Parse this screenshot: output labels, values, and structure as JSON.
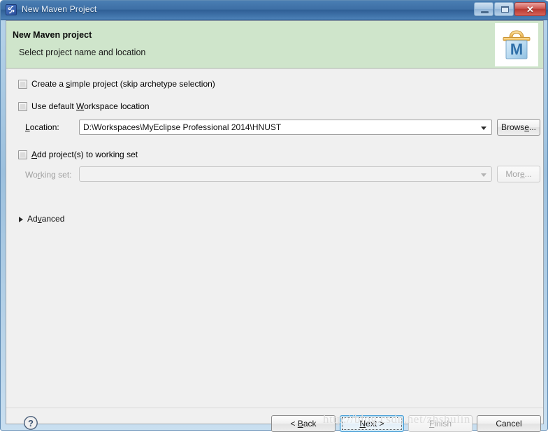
{
  "window": {
    "title": "New Maven Project",
    "icon": "myeclipse-logo-icon",
    "controls": {
      "minimize": "Minimize",
      "maximize": "Maximize",
      "close": "Close",
      "close_glyph": "✕"
    }
  },
  "banner": {
    "title": "New Maven project",
    "subtitle": "Select project name and location",
    "icon": "maven-project-icon",
    "icon_letter": "M",
    "background_color": "#cfe5cb"
  },
  "form": {
    "simple_project": {
      "label_before": "Create a ",
      "label_mnemonic": "s",
      "label_after": "imple project (skip archetype selection)",
      "checked": false
    },
    "default_workspace": {
      "label_before": "Use default ",
      "label_mnemonic": "W",
      "label_after": "orkspace location",
      "checked": false
    },
    "location": {
      "label_mnemonic": "L",
      "label_after": "ocation:",
      "value": "D:\\Workspaces\\MyEclipse Professional 2014\\HNUST",
      "browse_before": "Brows",
      "browse_mnemonic": "e",
      "browse_after": "...",
      "enabled": true
    },
    "working_set_checkbox": {
      "label_mnemonic": "A",
      "label_after": "dd project(s) to working set",
      "checked": false
    },
    "working_set": {
      "label_before": "Wo",
      "label_mnemonic": "r",
      "label_after": "king set:",
      "value": "",
      "more_before": "Mor",
      "more_mnemonic": "e",
      "more_after": "...",
      "enabled": false
    },
    "advanced": {
      "label_before": "Ad",
      "label_mnemonic": "v",
      "label_after": "anced",
      "expanded": false
    }
  },
  "footer": {
    "help": "?",
    "back": {
      "before": "< ",
      "mnemonic": "B",
      "after": "ack",
      "enabled": true,
      "focused": false
    },
    "next": {
      "before": "",
      "mnemonic": "N",
      "after": "ext >",
      "enabled": true,
      "focused": true
    },
    "finish": {
      "before": "",
      "mnemonic": "F",
      "after": "inish",
      "enabled": false,
      "focused": false
    },
    "cancel": {
      "before": "Cancel",
      "mnemonic": "",
      "after": "",
      "enabled": true,
      "focused": false
    }
  },
  "watermark": {
    "text": "http://blog.csdn.net/zhshulin"
  }
}
